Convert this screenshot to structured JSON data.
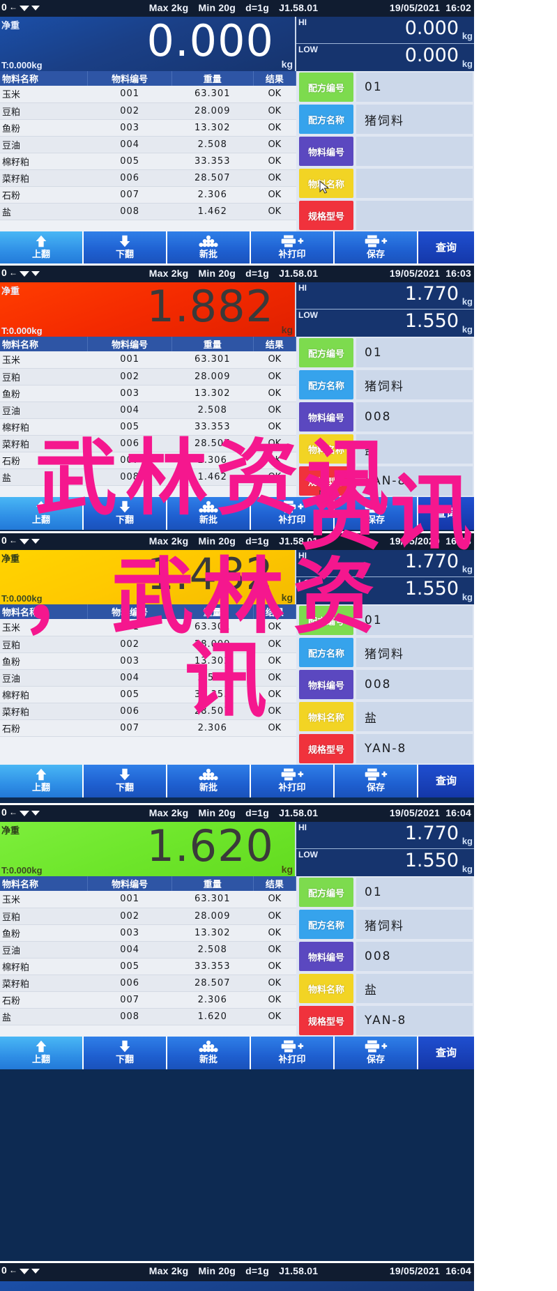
{
  "device": {
    "statusbar": {
      "zero_indicator": "0",
      "specs": [
        "Max 2kg",
        "Min 20g",
        "d=1g",
        "J1.58.01"
      ]
    },
    "table": {
      "headers": [
        "物料名称",
        "物料编号",
        "重量",
        "结果"
      ]
    },
    "field_labels": {
      "formula_no": "配方编号",
      "formula_name": "配方名称",
      "material_no": "物料编号",
      "material_name": "物料名称",
      "spec_model": "规格型号"
    },
    "field_colors": {
      "formula_no": "#7ddb4e",
      "formula_name": "#36a3ec",
      "material_no": "#5b48c0",
      "material_name": "#f2d424",
      "spec_model": "#f0323c"
    },
    "buttons": [
      {
        "label": "上翻",
        "icon": "arrow-up-icon"
      },
      {
        "label": "下翻",
        "icon": "arrow-down-icon"
      },
      {
        "label": "新批",
        "icon": "stack-icon"
      },
      {
        "label": "补打印",
        "icon": "printer-plus-icon"
      },
      {
        "label": "保存",
        "icon": "printer-plus-icon"
      }
    ],
    "query_button": {
      "label": "查询"
    },
    "unit": "kg",
    "hi_tag": "HI",
    "low_tag": "LOW"
  },
  "panels": [
    {
      "id": "panel-1",
      "date": "19/05/2021",
      "time": "16:02",
      "net_label": "净重",
      "tare": "T:0.000kg",
      "weight": "0.000",
      "weight_color": "#1b4fa8",
      "hi": "0.000",
      "low": "0.000",
      "fields": {
        "formula_no": "01",
        "formula_name": "猪饲料",
        "material_no": "",
        "material_name": "",
        "spec_model": ""
      },
      "rows": [
        {
          "name": "玉米",
          "no": "001",
          "weight": "63.301",
          "result": "OK"
        },
        {
          "name": "豆粕",
          "no": "002",
          "weight": "28.009",
          "result": "OK"
        },
        {
          "name": "鱼粉",
          "no": "003",
          "weight": "13.302",
          "result": "OK"
        },
        {
          "name": "豆油",
          "no": "004",
          "weight": "2.508",
          "result": "OK"
        },
        {
          "name": "棉籽粕",
          "no": "005",
          "weight": "33.353",
          "result": "OK"
        },
        {
          "name": "菜籽粕",
          "no": "006",
          "weight": "28.507",
          "result": "OK"
        },
        {
          "name": "石粉",
          "no": "007",
          "weight": "2.306",
          "result": "OK"
        },
        {
          "name": "盐",
          "no": "008",
          "weight": "1.462",
          "result": "OK"
        }
      ]
    },
    {
      "id": "panel-2",
      "date": "19/05/2021",
      "time": "16:03",
      "net_label": "净重",
      "tare": "T:0.000kg",
      "weight": "1.882",
      "weight_color": "#ff3d00",
      "hi": "1.770",
      "low": "1.550",
      "fields": {
        "formula_no": "01",
        "formula_name": "猪饲料",
        "material_no": "008",
        "material_name": "盐",
        "spec_model": "YAN-8"
      },
      "rows": [
        {
          "name": "玉米",
          "no": "001",
          "weight": "63.301",
          "result": "OK"
        },
        {
          "name": "豆粕",
          "no": "002",
          "weight": "28.009",
          "result": "OK"
        },
        {
          "name": "鱼粉",
          "no": "003",
          "weight": "13.302",
          "result": "OK"
        },
        {
          "name": "豆油",
          "no": "004",
          "weight": "2.508",
          "result": "OK"
        },
        {
          "name": "棉籽粕",
          "no": "005",
          "weight": "33.353",
          "result": "OK"
        },
        {
          "name": "菜籽粕",
          "no": "006",
          "weight": "28.507",
          "result": "OK"
        },
        {
          "name": "石粉",
          "no": "007",
          "weight": "2.306",
          "result": "OK"
        },
        {
          "name": "盐",
          "no": "008",
          "weight": "1.462",
          "result": "OK"
        }
      ]
    },
    {
      "id": "panel-3",
      "date": "19/05/2020",
      "time": "16:03",
      "net_label": "净重",
      "tare": "T:0.000kg",
      "weight": "1.482",
      "weight_color": "#ffd400",
      "hi": "1.770",
      "low": "1.550",
      "fields": {
        "formula_no": "01",
        "formula_name": "猪饲料",
        "material_no": "008",
        "material_name": "盐",
        "spec_model": "YAN-8"
      },
      "rows": [
        {
          "name": "玉米",
          "no": "001",
          "weight": "63.301",
          "result": "OK"
        },
        {
          "name": "豆粕",
          "no": "002",
          "weight": "28.009",
          "result": "OK"
        },
        {
          "name": "鱼粉",
          "no": "003",
          "weight": "13.302",
          "result": "OK"
        },
        {
          "name": "豆油",
          "no": "004",
          "weight": "2.508",
          "result": "OK"
        },
        {
          "name": "棉籽粕",
          "no": "005",
          "weight": "33.353",
          "result": "OK"
        },
        {
          "name": "菜籽粕",
          "no": "006",
          "weight": "28.507",
          "result": "OK"
        },
        {
          "name": "石粉",
          "no": "007",
          "weight": "2.306",
          "result": "OK"
        }
      ]
    },
    {
      "id": "panel-4",
      "date": "19/05/2021",
      "time": "16:04",
      "net_label": "净重",
      "tare": "T:0.000kg",
      "weight": "1.620",
      "weight_color": "#7dee3c",
      "hi": "1.770",
      "low": "1.550",
      "fields": {
        "formula_no": "01",
        "formula_name": "猪饲料",
        "material_no": "008",
        "material_name": "盐",
        "spec_model": "YAN-8"
      },
      "rows": [
        {
          "name": "玉米",
          "no": "001",
          "weight": "63.301",
          "result": "OK"
        },
        {
          "name": "豆粕",
          "no": "002",
          "weight": "28.009",
          "result": "OK"
        },
        {
          "name": "鱼粉",
          "no": "003",
          "weight": "13.302",
          "result": "OK"
        },
        {
          "name": "豆油",
          "no": "004",
          "weight": "2.508",
          "result": "OK"
        },
        {
          "name": "棉籽粕",
          "no": "005",
          "weight": "33.353",
          "result": "OK"
        },
        {
          "name": "菜籽粕",
          "no": "006",
          "weight": "28.507",
          "result": "OK"
        },
        {
          "name": "石粉",
          "no": "007",
          "weight": "2.306",
          "result": "OK"
        },
        {
          "name": "盐",
          "no": "008",
          "weight": "1.620",
          "result": "OK"
        }
      ]
    },
    {
      "id": "panel-5",
      "date": "19/05/2021",
      "time": "16:04"
    }
  ],
  "watermark": {
    "line1": "武林资讯",
    "line2": "，武林资",
    "line3": "讯",
    "line4": "资讯",
    "color": "#f5178e"
  }
}
